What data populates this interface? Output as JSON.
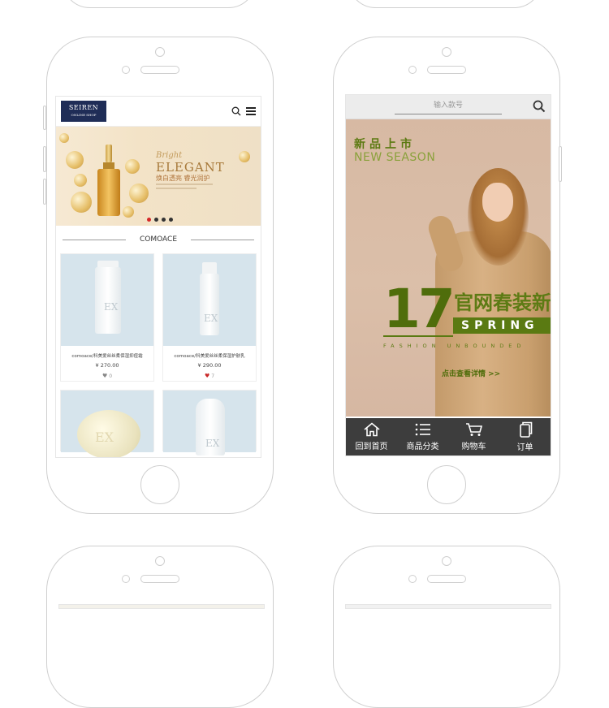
{
  "left_phone": {
    "logo": {
      "name": "SEIREN",
      "sub": "ONLINE SHOP"
    },
    "banner": {
      "script_text": "Bright",
      "title": "ELEGANT",
      "cn_tagline": "焕白透亮 睿光润护",
      "carousel_dots": 4,
      "active_dot": 1
    },
    "section_title": "COMOACE",
    "products": [
      {
        "name": "comoace/科美爱丝丝柔保湿抑痘霜",
        "price": "¥ 270.00",
        "likes": "0",
        "liked": false,
        "tube_text": "EX"
      },
      {
        "name": "comoace/科美爱丝丝柔保湿护肤乳",
        "price": "¥ 290.00",
        "likes": "7",
        "liked": true,
        "tube_text": "EX"
      },
      {
        "tube_text": "EX"
      },
      {
        "tube_text": "EX"
      }
    ]
  },
  "right_phone": {
    "search": {
      "placeholder": "输入款号"
    },
    "hero": {
      "new_cn": "新品上市",
      "new_en": "NEW SEASON",
      "promo_number": "17",
      "promo_cn": "官网春装新",
      "spring": "SPRING",
      "fashion_line": "FASHION UNBOUNDED",
      "cta": "点击查看详情 >>"
    },
    "tabbar": [
      {
        "label": "回到首页",
        "icon": "home-icon"
      },
      {
        "label": "商品分类",
        "icon": "list-icon"
      },
      {
        "label": "购物车",
        "icon": "cart-icon"
      },
      {
        "label": "订单",
        "icon": "order-icon"
      }
    ]
  },
  "colors": {
    "brand_navy": "#1f2d57",
    "heart_red": "#c82828",
    "promo_green": "#4f6d0b",
    "tabbar_bg": "#3d3d3d"
  }
}
